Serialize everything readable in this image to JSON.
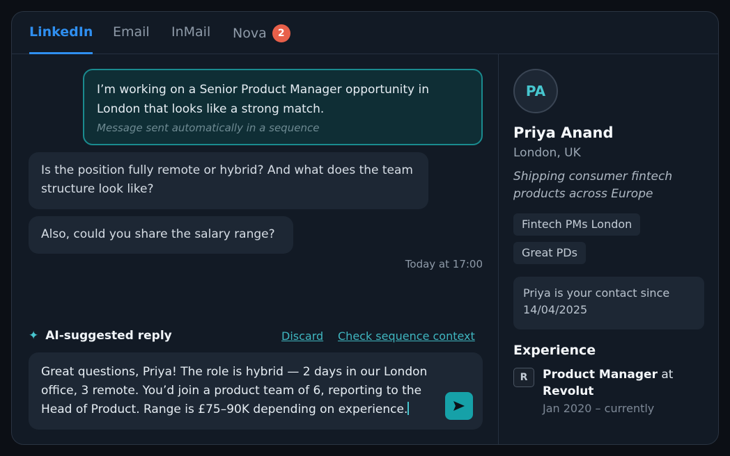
{
  "tabs": [
    {
      "label": "LinkedIn"
    },
    {
      "label": "Email"
    },
    {
      "label": "InMail"
    },
    {
      "label": "Nova",
      "badge": "2"
    }
  ],
  "conversation": {
    "outgoing": {
      "text": "I’m working on a Senior Product Manager opportunity in London that looks like a strong match.",
      "note": "Message sent automatically in a sequence"
    },
    "incoming": [
      {
        "text": "Is the position fully remote or hybrid? And what does the team structure look like?"
      },
      {
        "text": "Also, could you share the salary range?"
      }
    ],
    "timestamp": "Today at 17:00"
  },
  "ai_reply": {
    "title": "AI-suggested reply",
    "discard_label": "Discard",
    "context_label": "Check sequence context",
    "text": "Great questions, Priya! The role is hybrid — 2 days in our London office, 3 remote. You’d join a product team of 6, reporting to the Head of Product. Range is £75–90K depending on experience."
  },
  "profile": {
    "initials": "PA",
    "name": "Priya Anand",
    "location": "London, UK",
    "headline": "Shipping consumer fintech products across Europe",
    "tags": [
      "Fintech PMs London",
      "Great PDs"
    ],
    "contact_since": "Priya is your contact since 14/04/2025",
    "experience_title": "Experience",
    "experience": [
      {
        "logo": "R",
        "role": "Product Manager",
        "at": " at ",
        "company": "Revolut",
        "dates": "Jan 2020 – currently"
      }
    ]
  },
  "colors": {
    "accent": "#2f8ff0",
    "teal": "#16a1a8",
    "badge": "#e8604a"
  }
}
